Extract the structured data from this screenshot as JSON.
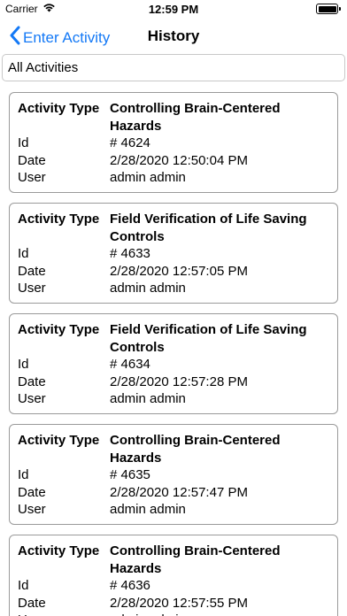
{
  "status_bar": {
    "carrier": "Carrier",
    "time": "12:59 PM",
    "wifi_icon": "wifi-icon",
    "battery_icon": "battery-icon"
  },
  "nav": {
    "back_label": "Enter Activity",
    "back_icon": "chevron-left-icon",
    "title": "History",
    "accent_color": "#1479f6"
  },
  "filter": {
    "value": "All Activities"
  },
  "labels": {
    "activity_type": "Activity Type",
    "id": "Id",
    "date": "Date",
    "user": "User"
  },
  "activities": [
    {
      "type": "Controlling Brain-Centered Hazards",
      "id": "# 4624",
      "date": "2/28/2020 12:50:04 PM",
      "user": "admin admin"
    },
    {
      "type": "Field Verification of Life Saving Controls",
      "id": "# 4633",
      "date": "2/28/2020 12:57:05 PM",
      "user": "admin admin"
    },
    {
      "type": "Field Verification of Life Saving Controls",
      "id": "# 4634",
      "date": "2/28/2020 12:57:28 PM",
      "user": "admin admin"
    },
    {
      "type": "Controlling Brain-Centered Hazards",
      "id": "# 4635",
      "date": "2/28/2020 12:57:47 PM",
      "user": "admin admin"
    },
    {
      "type": "Controlling Brain-Centered Hazards",
      "id": "# 4636",
      "date": "2/28/2020 12:57:55 PM",
      "user": "admin admin"
    }
  ]
}
